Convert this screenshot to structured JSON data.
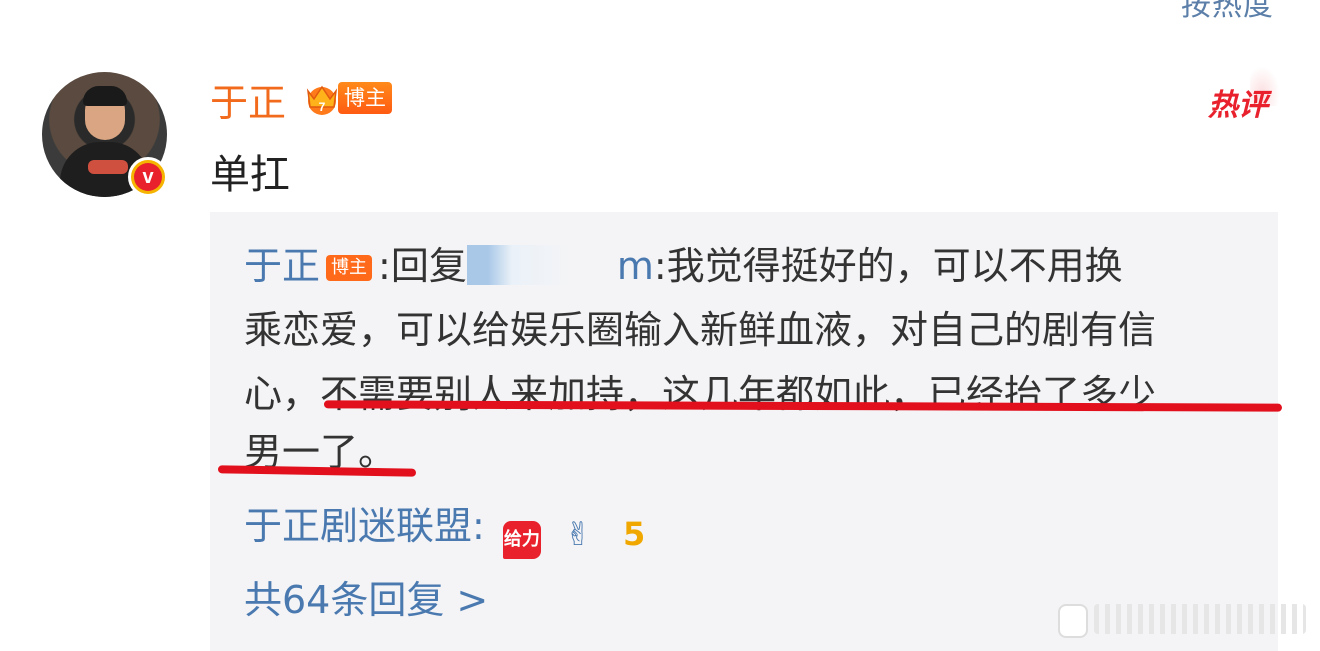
{
  "header": {
    "sort_label": "按热度"
  },
  "comment": {
    "username": "于正",
    "badge": "博主",
    "hot_label": "热评",
    "text": "单扛"
  },
  "reply": {
    "author": "于正",
    "author_badge": "博主",
    "prefix": ":回复",
    "target_suffix": "m",
    "line1": ":我觉得挺好的，可以不用换",
    "line2": "乘恋爱，可以给娱乐圈输入新鲜血液，对自己的剧有信",
    "line3": "心，不需要别人来加持，这几年都如此，已经抬了多少",
    "line4": "男一了。"
  },
  "fan_reply": {
    "author": "于正剧迷联盟:",
    "emoji_1": "给力",
    "emoji_2": "✌",
    "emoji_3": "5"
  },
  "more": {
    "label": "共64条回复 >"
  },
  "colors": {
    "link": "#4a79b0",
    "username": "#f26a1b",
    "hot": "#e8212c",
    "underline": "#e2101c"
  }
}
